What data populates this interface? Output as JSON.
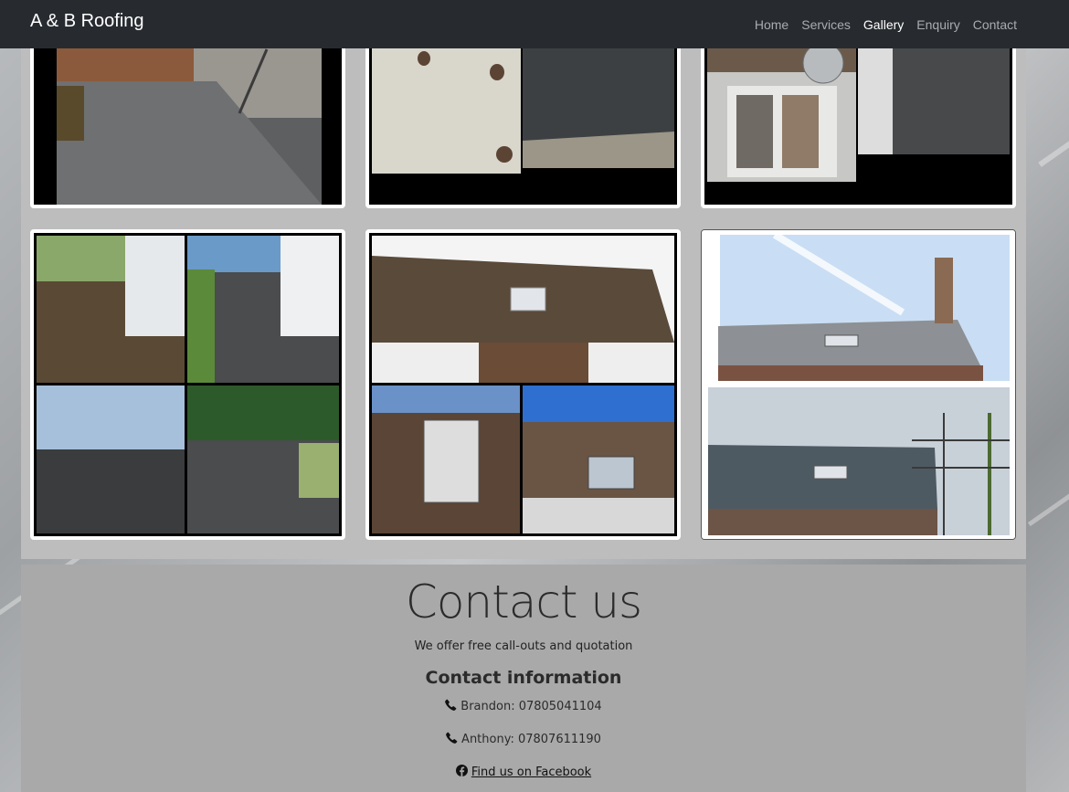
{
  "navbar": {
    "brand": "A & B Roofing",
    "links": [
      {
        "label": "Home",
        "active": false
      },
      {
        "label": "Services",
        "active": false
      },
      {
        "label": "Gallery",
        "active": true
      },
      {
        "label": "Enquiry",
        "active": false
      },
      {
        "label": "Contact",
        "active": false
      }
    ]
  },
  "colors": {
    "navbar_bg": "#272b30",
    "nav_active": "#ffffff",
    "nav_inactive": "#a9acaf",
    "gallery_bg": "#bdbdbd",
    "contact_bg": "#a9a9a9"
  },
  "contact": {
    "title": "Contact us",
    "subtitle": "We offer free call-outs and quotation",
    "info_heading": "Contact information",
    "phones": [
      {
        "text": "Brandon: 07805041104",
        "icon": "phone-icon"
      },
      {
        "text": "Anthony: 07807611190",
        "icon": "phone-icon"
      }
    ],
    "facebook": {
      "text": " Find us on Facebook",
      "icon": "facebook-icon"
    }
  }
}
